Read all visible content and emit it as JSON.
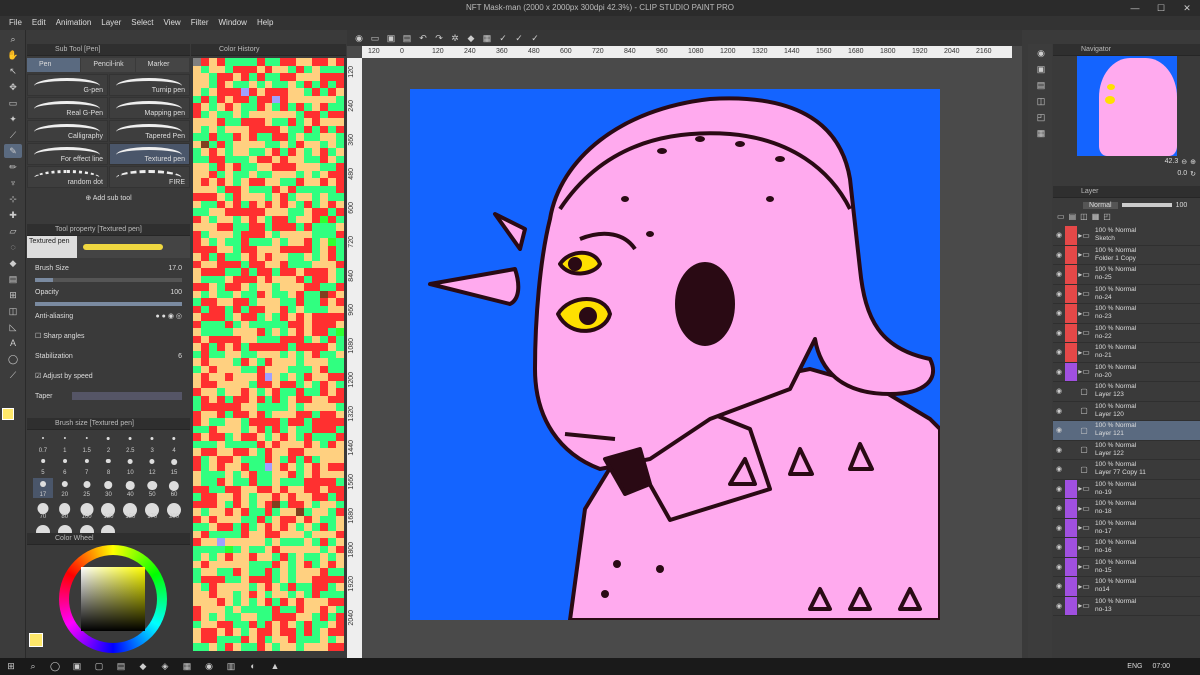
{
  "window": {
    "title": "NFT Mask-man (2000 x 2000px 300dpi 42.3%) - CLIP STUDIO PAINT PRO"
  },
  "menu": [
    "File",
    "Edit",
    "Animation",
    "Layer",
    "Select",
    "View",
    "Filter",
    "Window",
    "Help"
  ],
  "subtool": {
    "header": "Sub Tool [Pen]",
    "tabs": [
      "Pen",
      "Pencil-ink",
      "Marker"
    ],
    "brushes": [
      "G-pen",
      "Turnip pen",
      "Real G-Pen",
      "Mapping pen",
      "Calligraphy",
      "Tapered Pen",
      "For effect line",
      "Textured pen",
      "random dot",
      "FIRE"
    ],
    "add_label": "Add sub tool"
  },
  "toolprop": {
    "header": "Tool property [Textured pen]",
    "tool_name": "Textured pen",
    "brush_size_label": "Brush Size",
    "brush_size_value": "17.0",
    "opacity_label": "Opacity",
    "opacity_value": "100",
    "antialias_label": "Anti-aliasing",
    "sharp_label": "Sharp angles",
    "stabilization_label": "Stabilization",
    "stabilization_value": "6",
    "adjust_label": "Adjust by speed",
    "taper_label": "Taper"
  },
  "brushsize": {
    "header": "Brush size [Textured pen]",
    "sizes": [
      "0.7",
      "1",
      "1.5",
      "2",
      "2.5",
      "3",
      "4",
      "5",
      "6",
      "7",
      "8",
      "10",
      "12",
      "15",
      "17",
      "20",
      "25",
      "30",
      "40",
      "50",
      "60",
      "70",
      "80",
      "100",
      "120",
      "150",
      "170",
      "200",
      "250",
      "300",
      "400",
      "500"
    ]
  },
  "colorwheel": {
    "header": "Color Wheel"
  },
  "colorhist": {
    "header": "Color History"
  },
  "hruler": [
    "120",
    "0",
    "120",
    "240",
    "360",
    "480",
    "600",
    "720",
    "840",
    "960",
    "1080",
    "1200",
    "1320",
    "1440",
    "1560",
    "1680",
    "1800",
    "1920",
    "2040",
    "2160"
  ],
  "vruler": [
    "120",
    "240",
    "360",
    "480",
    "600",
    "720",
    "840",
    "960",
    "1080",
    "1200",
    "1320",
    "1440",
    "1560",
    "1680",
    "1800",
    "1920",
    "2040"
  ],
  "navigator": {
    "header": "Navigator",
    "zoom": "42.3",
    "angle": "0.0"
  },
  "layers": {
    "header": "Layer",
    "blend": "Normal",
    "opacity": "100",
    "items": [
      {
        "pct": "100 % Normal",
        "name": "Sketch",
        "type": "folder"
      },
      {
        "pct": "100 % Normal",
        "name": "Folder 1 Copy",
        "type": "folder"
      },
      {
        "pct": "100 % Normal",
        "name": "no-25",
        "type": "folder"
      },
      {
        "pct": "100 % Normal",
        "name": "no-24",
        "type": "folder"
      },
      {
        "pct": "100 % Normal",
        "name": "no-23",
        "type": "folder"
      },
      {
        "pct": "100 % Normal",
        "name": "no-22",
        "type": "folder"
      },
      {
        "pct": "100 % Normal",
        "name": "no-21",
        "type": "folder"
      },
      {
        "pct": "100 % Normal",
        "name": "no-20",
        "type": "folder"
      },
      {
        "pct": "100 % Normal",
        "name": "Layer 123",
        "type": "layer"
      },
      {
        "pct": "100 % Normal",
        "name": "Layer 120",
        "type": "layer"
      },
      {
        "pct": "100 % Normal",
        "name": "Layer 121",
        "type": "layer"
      },
      {
        "pct": "100 % Normal",
        "name": "Layer 122",
        "type": "layer"
      },
      {
        "pct": "100 % Normal",
        "name": "Layer 77 Copy 11",
        "type": "layer"
      },
      {
        "pct": "100 % Normal",
        "name": "no-19",
        "type": "folder"
      },
      {
        "pct": "100 % Normal",
        "name": "no-18",
        "type": "folder"
      },
      {
        "pct": "100 % Normal",
        "name": "no-17",
        "type": "folder"
      },
      {
        "pct": "100 % Normal",
        "name": "no-16",
        "type": "folder"
      },
      {
        "pct": "100 % Normal",
        "name": "no-15",
        "type": "folder"
      },
      {
        "pct": "100 % Normal",
        "name": "no14",
        "type": "folder"
      },
      {
        "pct": "100 % Normal",
        "name": "no-13",
        "type": "folder"
      }
    ]
  },
  "taskbar": {
    "lang": "ENG",
    "time": "07:00"
  },
  "colors": {
    "canvas_bg": "#1464ff",
    "skin": "#ffaaee",
    "line": "#2a0a14",
    "eye": "#ffe000",
    "accent": "#5a6a80"
  }
}
